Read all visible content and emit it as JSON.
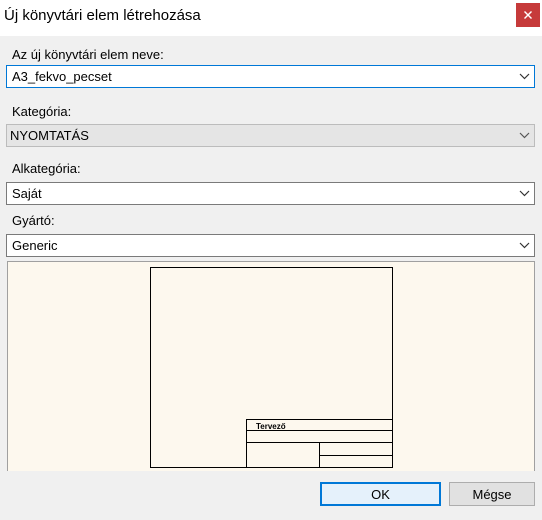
{
  "window": {
    "title": "Új könyvtári elem létrehozása",
    "close_glyph": "×"
  },
  "fields": {
    "name": {
      "label": "Az új könyvtári elem neve:",
      "value": "A3_fekvo_pecset"
    },
    "category": {
      "label": "Kategória:",
      "value": "NYOMTATÁS"
    },
    "subcategory": {
      "label": "Alkategória:",
      "value": "Saját"
    },
    "manufacturer": {
      "label": "Gyártó:",
      "value": "Generic"
    }
  },
  "preview": {
    "title_block_text": "Tervező"
  },
  "buttons": {
    "ok": "OK",
    "cancel": "Mégse"
  },
  "colors": {
    "close_button": "#c63a3a",
    "focus_accent": "#0078d7",
    "preview_background": "#fdf8ee"
  },
  "icons": {
    "close": "close-icon",
    "dropdown": "chevron-down-icon"
  }
}
